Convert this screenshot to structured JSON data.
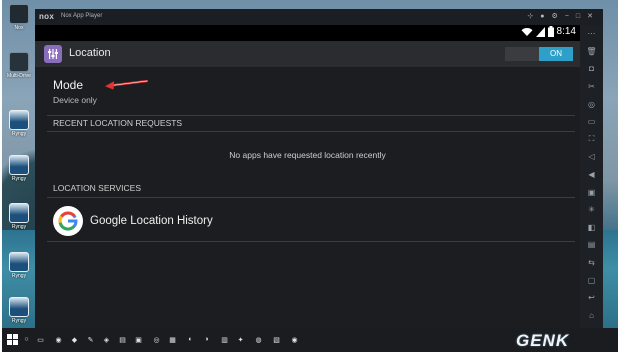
{
  "desktop": {
    "icons": [
      {
        "label": "Nox",
        "glyph": "nox-icon"
      },
      {
        "label": "Multi-Drive",
        "glyph": "multi-drive-icon"
      },
      {
        "label": "Ryngy",
        "glyph": "window-icon"
      },
      {
        "label": "Ryngy",
        "glyph": "window-icon"
      },
      {
        "label": "Ryngy",
        "glyph": "window-icon"
      },
      {
        "label": "Ryngy",
        "glyph": "window-icon"
      },
      {
        "label": "Ryngy",
        "glyph": "window-icon"
      }
    ]
  },
  "window": {
    "logo": "nox",
    "title": "Nox App Player"
  },
  "status_bar": {
    "time": "8:14"
  },
  "action_bar": {
    "title": "Location",
    "toggle_label": "ON"
  },
  "mode": {
    "title": "Mode",
    "value": "Device only"
  },
  "recent_requests": {
    "header": "RECENT LOCATION REQUESTS",
    "empty_message": "No apps have requested location recently"
  },
  "location_services": {
    "header": "LOCATION SERVICES",
    "items": [
      {
        "label": "Google Location History",
        "icon": "google-g-icon"
      }
    ]
  },
  "watermark": "GENK",
  "colors": {
    "accent": "#2e9fc9",
    "screen_bg": "#1b1d20",
    "action_bar_bg": "#2a2c2f",
    "arrow": "#e23434"
  }
}
